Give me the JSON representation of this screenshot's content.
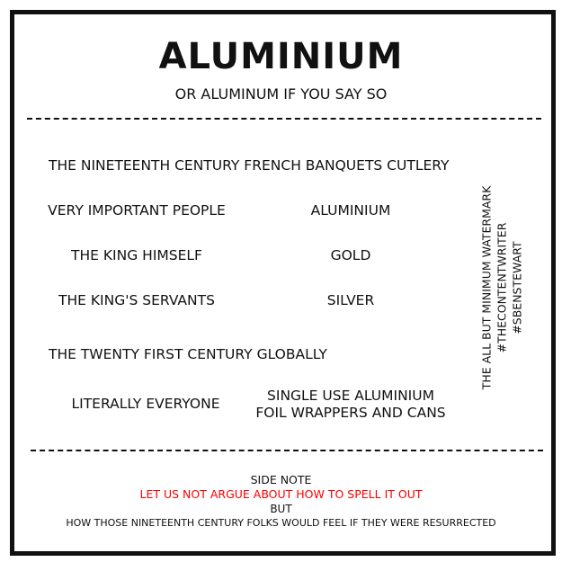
{
  "title": "ALUMINIUM",
  "subtitle": "OR ALUMINUM IF YOU SAY SO",
  "section1": {
    "heading": "THE NINETEENTH CENTURY FRENCH BANQUETS CUTLERY",
    "rows": [
      {
        "who": "VERY IMPORTANT PEOPLE",
        "what": "ALUMINIUM"
      },
      {
        "who": "THE KING HIMSELF",
        "what": "GOLD"
      },
      {
        "who": "THE KING'S SERVANTS",
        "what": "SILVER"
      }
    ]
  },
  "section2": {
    "heading": "THE TWENTY FIRST CENTURY GLOBALLY",
    "who": "LITERALLY EVERYONE",
    "what_line1": "SINGLE USE ALUMINIUM",
    "what_line2": "FOIL WRAPPERS  AND CANS"
  },
  "watermark": {
    "line1": "THE ALL BUT MINIMUM WATERMARK",
    "line2": "#THECONTENTWRITER #SBENSTEWART"
  },
  "side_note": {
    "label": "SIDE NOTE",
    "highlight": "LET US NOT ARGUE ABOUT HOW TO SPELL IT OUT",
    "but": "BUT",
    "closing": "HOW THOSE NINETEENTH CENTURY FOLKS WOULD FEEL IF THEY WERE RESURRECTED"
  },
  "colors": {
    "ink": "#111111",
    "highlight": "#ff0000",
    "background": "#ffffff"
  }
}
